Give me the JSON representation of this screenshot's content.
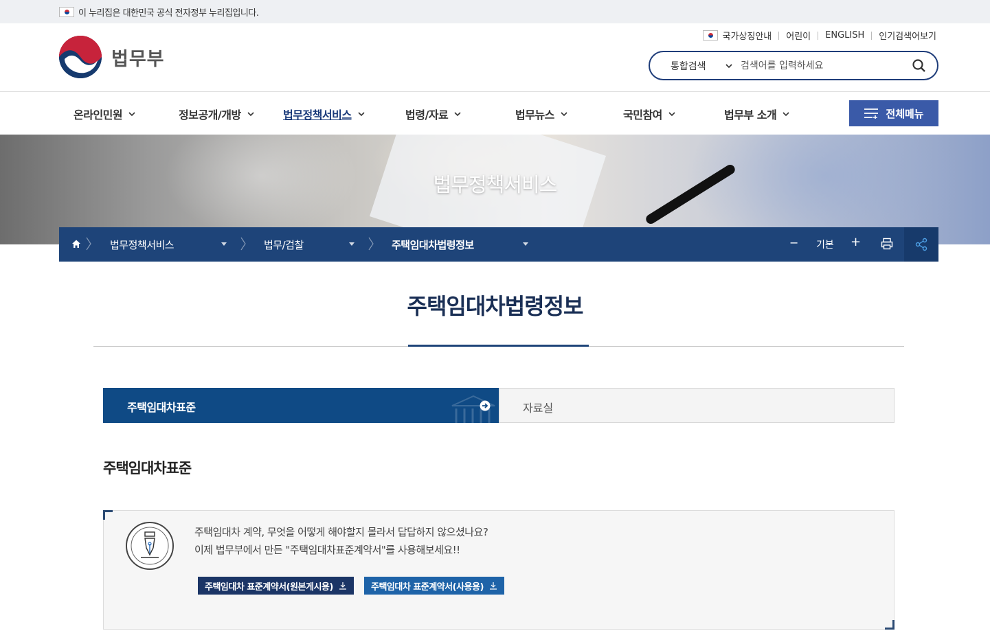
{
  "gov_bar": {
    "text": "이 누리집은 대한민국 공식 전자정부 누리집입니다."
  },
  "header": {
    "logo_text": "법무부",
    "util_links": [
      "국가상징안내",
      "어린이",
      "ENGLISH",
      "인기검색어보기"
    ],
    "search": {
      "scope": "통합검색",
      "placeholder": "검색어를 입력하세요"
    }
  },
  "gnb": {
    "items": [
      {
        "label": "온라인민원"
      },
      {
        "label": "정보공개/개방"
      },
      {
        "label": "법무정책서비스"
      },
      {
        "label": "법령/자료"
      },
      {
        "label": "법무뉴스"
      },
      {
        "label": "국민참여"
      },
      {
        "label": "법무부 소개"
      }
    ],
    "active_index": 2,
    "all_menu_label": "전체메뉴"
  },
  "banner": {
    "title": "법무정책서비스"
  },
  "location": {
    "crumbs": [
      "법무정책서비스",
      "법무/검찰",
      "주택임대차법령정보"
    ],
    "font_minus": "−",
    "font_default": "기본",
    "font_plus": "+"
  },
  "page_title": "주택임대차법령정보",
  "tabs": {
    "active": "주택임대차표준",
    "inactive": "자료실"
  },
  "section": {
    "title": "주택임대차표준",
    "lines": [
      "주택임대차 계약, 무엇을 어떻게 해야할지 몰라서 답답하지 않으셨나요?",
      "이제 법무부에서 만든 \"주택임대차표준계약서\"를 사용해보세요!!"
    ],
    "buttons": [
      {
        "label": "주택임대차 표준계약서(원본게시용)",
        "color": "#1b3566"
      },
      {
        "label": "주택임대차 표준계약서(사용용)",
        "color": "#1e63a8"
      }
    ]
  },
  "colors": {
    "primary": "#1e4479",
    "tab_active": "#0f4a85",
    "all_menu": "#3a5aa8"
  }
}
